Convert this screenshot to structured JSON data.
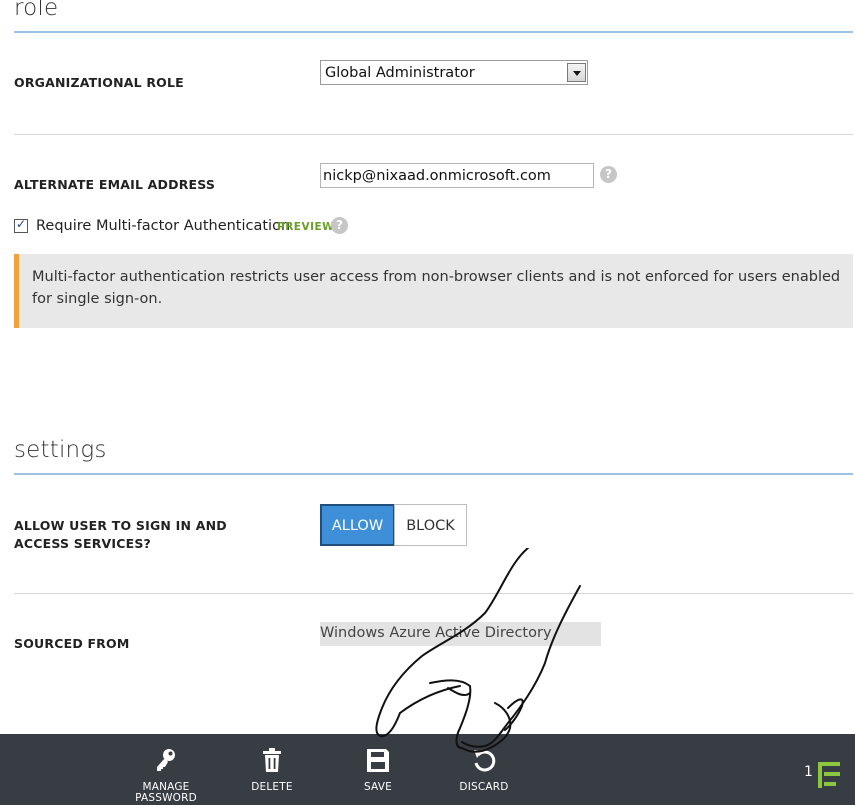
{
  "role_section": {
    "title": "role",
    "organizational_role_label": "ORGANIZATIONAL ROLE",
    "organizational_role_value": "Global Administrator",
    "alternate_email_label": "ALTERNATE EMAIL ADDRESS",
    "alternate_email_value": "nickp@nixaad.onmicrosoft.com",
    "mfa_checkbox_label": "Require Multi-factor Authentication",
    "mfa_checked": true,
    "preview_badge": "PREVIEW",
    "notice_text": "Multi-factor authentication restricts user access from non-browser clients and is not enforced for users enabled for single sign-on."
  },
  "settings_section": {
    "title": "settings",
    "sign_in_label": "ALLOW USER TO SIGN IN AND ACCESS SERVICES?",
    "allow_label": "ALLOW",
    "block_label": "BLOCK",
    "selected": "ALLOW",
    "sourced_from_label": "SOURCED FROM",
    "sourced_from_value": "Windows Azure Active Directory"
  },
  "command_bar": {
    "manage_password_label": "MANAGE PASSWORD",
    "delete_label": "DELETE",
    "save_label": "SAVE",
    "discard_label": "DISCARD",
    "notification_count": "1"
  },
  "colors": {
    "accent": "#3e8fd8",
    "section_rule": "#9cc3e6",
    "notice_stripe": "#f0a33a",
    "preview_badge": "#6a9e28",
    "command_bar_bg": "#383d44",
    "notification_icon": "#8cc63f"
  },
  "icons": {
    "manage_password": "key-icon",
    "delete": "trash-icon",
    "save": "floppy-disk-icon",
    "discard": "undo-icon",
    "help": "question-circle-icon",
    "notifications": "list-icon",
    "pointer": "hand-pointer-icon"
  }
}
